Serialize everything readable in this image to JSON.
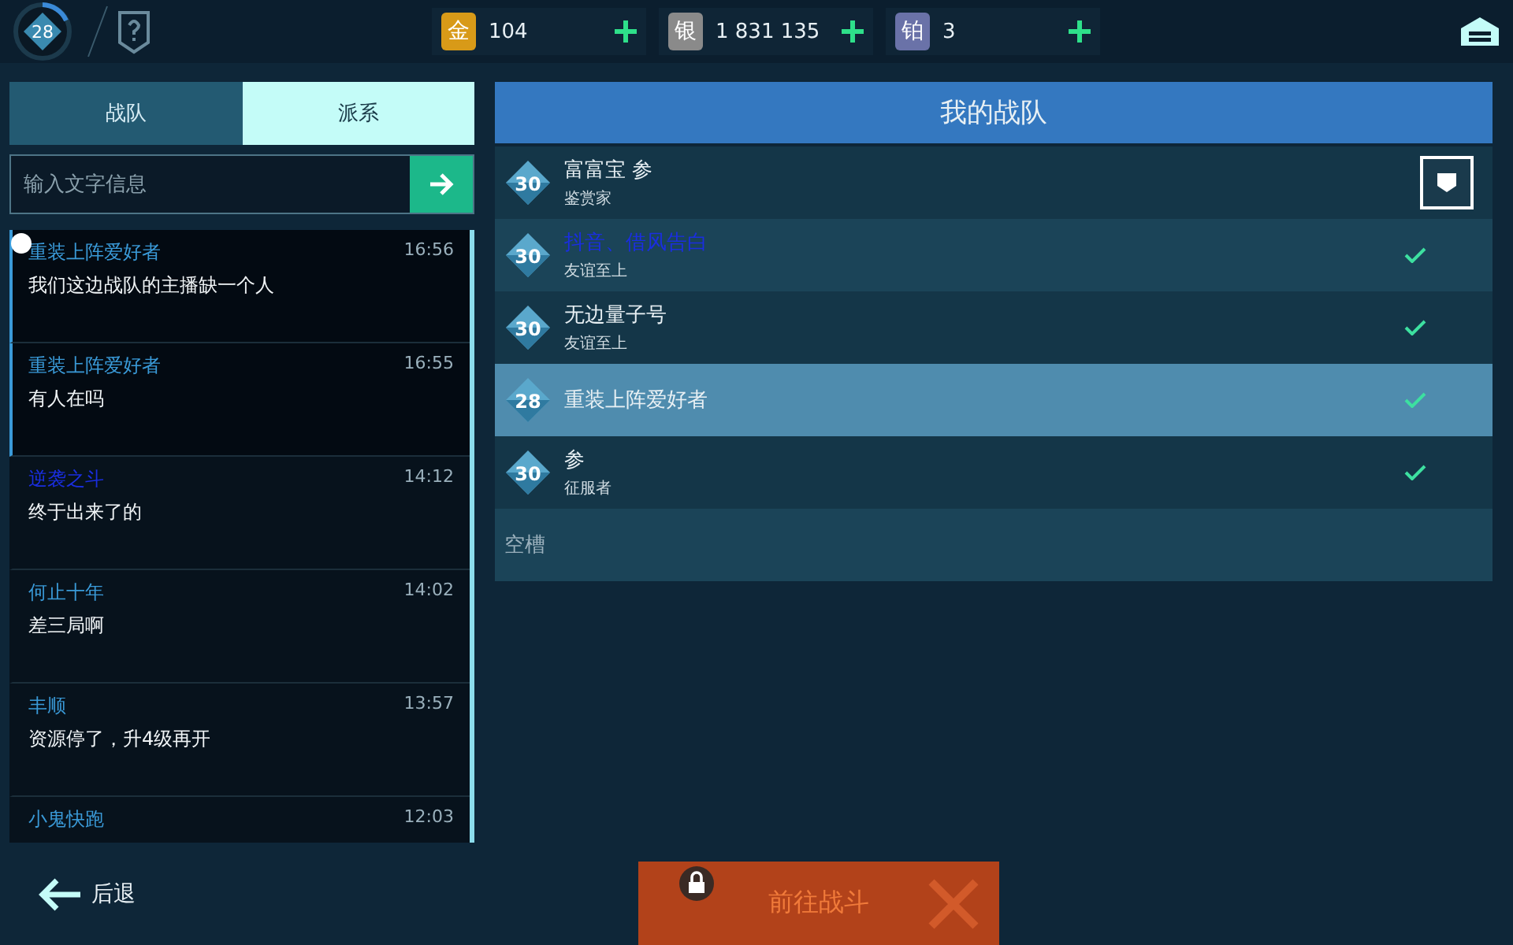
{
  "player": {
    "level": "28"
  },
  "currencies": [
    {
      "kind": "gold",
      "symbol": "金",
      "amount": "104"
    },
    {
      "kind": "silver",
      "symbol": "银",
      "amount": "1 831 135"
    },
    {
      "kind": "platinum",
      "symbol": "铂",
      "amount": "3"
    }
  ],
  "tabs": [
    {
      "label": "战队",
      "selected": false
    },
    {
      "label": "派系",
      "selected": true
    }
  ],
  "message_input": {
    "placeholder": "输入文字信息"
  },
  "chat": [
    {
      "name": "重装上阵爱好者",
      "color": "#3a9ad8",
      "time": "16:56",
      "text": "我们这边战队的主播缺一个人",
      "highlighted": true,
      "unread": true
    },
    {
      "name": "重装上阵爱好者",
      "color": "#3a9ad8",
      "time": "16:55",
      "text": "有人在吗",
      "highlighted": true,
      "unread": false
    },
    {
      "name": "逆袭之斗",
      "color": "#1a2ee0",
      "time": "14:12",
      "text": "终于出来了的",
      "highlighted": false,
      "unread": false
    },
    {
      "name": "何止十年",
      "color": "#3a9ad8",
      "time": "14:02",
      "text": "差三局啊",
      "highlighted": false,
      "unread": false
    },
    {
      "name": "丰顺",
      "color": "#3a9ad8",
      "time": "13:57",
      "text": "资源停了，升4级再开",
      "highlighted": false,
      "unread": false
    },
    {
      "name": "小鬼快跑",
      "color": "#3a9ad8",
      "time": "12:03",
      "highlighted": false,
      "unread": false
    }
  ],
  "team": {
    "title": "我的战队",
    "members": [
      {
        "level": "30",
        "name": "富富宝 参",
        "color": "#e8f0f4",
        "rank": "鉴赏家",
        "kind": "leader",
        "selected": false
      },
      {
        "level": "30",
        "name": "抖音、借风告白",
        "color": "#1a2ee0",
        "rank": "友谊至上",
        "kind": "ready",
        "selected": false
      },
      {
        "level": "30",
        "name": "无边量子号",
        "color": "#e8f0f4",
        "rank": "友谊至上",
        "kind": "ready",
        "selected": false
      },
      {
        "level": "28",
        "name": "重装上阵爱好者",
        "color": "#e8f0f4",
        "kind": "ready",
        "selected": true
      },
      {
        "level": "30",
        "name": "参",
        "color": "#e8f0f4",
        "rank": "征服者",
        "kind": "ready",
        "selected": false
      }
    ],
    "empty_slot": "空槽"
  },
  "back_button": "后退",
  "battle_button": {
    "label": "前往战斗",
    "locked": true
  }
}
